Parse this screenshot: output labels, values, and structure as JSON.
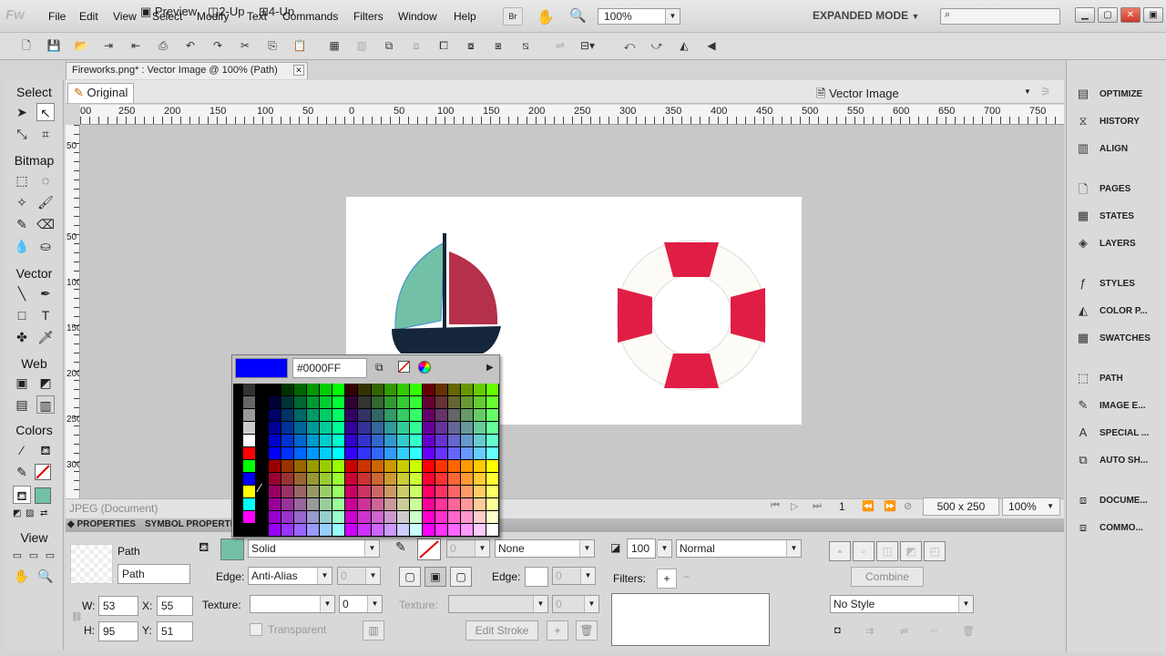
{
  "app": {
    "logo": "Fw"
  },
  "menu": [
    "File",
    "Edit",
    "View",
    "Select",
    "Modify",
    "Text",
    "Commands",
    "Filters",
    "Window",
    "Help"
  ],
  "menubar": {
    "br_label": "Br",
    "zoom": "100%",
    "mode": "EXPANDED MODE"
  },
  "document": {
    "tab_title": "Fireworks.png* : Vector Image @ 100% (Path)"
  },
  "tools": {
    "select_header": "Select",
    "bitmap_header": "Bitmap",
    "vector_header": "Vector",
    "web_header": "Web",
    "colors_header": "Colors",
    "view_header": "View"
  },
  "view_tabs": {
    "original": "Original",
    "preview": "Preview",
    "two_up": "2-Up",
    "four_up": "4-Up",
    "image_type": "Vector Image"
  },
  "ruler": {
    "h_labels": [
      "00",
      "250",
      "200",
      "150",
      "100",
      "50",
      "0",
      "50",
      "100",
      "150",
      "200",
      "250",
      "300",
      "350",
      "400",
      "450",
      "500",
      "550",
      "600",
      "650",
      "700",
      "750"
    ],
    "v_labels": [
      "50",
      "50",
      "100",
      "150",
      "200",
      "250",
      "300"
    ]
  },
  "status": {
    "doc_type": "JPEG (Document)",
    "page": "1",
    "size": "500 x 250",
    "zoom": "100%"
  },
  "props_tabs": {
    "properties": "PROPERTIES",
    "symbol": "SYMBOL PROPERTIES"
  },
  "props": {
    "object_type": "Path",
    "object_name": "Path",
    "w_label": "W:",
    "w": "53",
    "x_label": "X:",
    "x": "55",
    "h_label": "H:",
    "h": "95",
    "y_label": "Y:",
    "y": "51",
    "fill_type": "Solid",
    "edge_label": "Edge:",
    "edge_value": "Anti-Alias",
    "edge_amount": "0",
    "texture_label": "Texture:",
    "texture_amount": "0",
    "transparent_label": "Transparent",
    "stroke_size": "0",
    "stroke_type": "None",
    "stroke_edge_label": "Edge:",
    "stroke_edge_amount": "0",
    "stroke_texture_label": "Texture:",
    "stroke_texture_amount": "0",
    "edit_stroke": "Edit Stroke",
    "opacity": "100",
    "blend": "Normal",
    "filters_label": "Filters:",
    "filters_add": "+",
    "filters_remove": "−",
    "combine": "Combine",
    "style": "No Style"
  },
  "picker": {
    "swatch": "#0000FF",
    "hex": "#0000FF"
  },
  "right_panels": [
    "OPTIMIZE",
    "HISTORY",
    "ALIGN",
    "PAGES",
    "STATES",
    "LAYERS",
    "STYLES",
    "COLOR P...",
    "SWATCHES",
    "PATH",
    "IMAGE E...",
    "SPECIAL ...",
    "AUTO SH...",
    "DOCUME...",
    "COMMO..."
  ],
  "colors": {
    "fill": "#72C1A6",
    "sail_right": "#B5304A",
    "hull": "#15263A",
    "ring": "#E01E45",
    "ring_bg": "#FDFBF6"
  }
}
